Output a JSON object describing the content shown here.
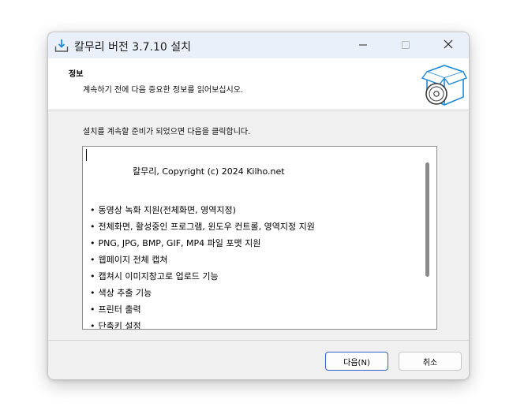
{
  "window": {
    "title": "칼무리 버전 3.7.10 설치"
  },
  "header": {
    "title": "정보",
    "subtitle": "계속하기 전에 다음 중요한 정보를 읽어보십시오."
  },
  "main": {
    "instruction": "설치를 계속할 준비가 되었으면 다음을 클릭합니다.",
    "copyright": "칼무리, Copyright (c) 2024 Kilho.net",
    "bullet": "•",
    "features": [
      "동영상 녹화 지원(전체화면, 영역지정)",
      "전체화면, 활성중인 프로그램, 윈도우 컨트롤, 영역지정 지원",
      "PNG, JPG, BMP, GIF, MP4 파일 포맷 지원",
      "웹페이지 전체 캡쳐",
      "캡쳐시 이미지창고로 업로드 기능",
      "색상 추출 기능",
      "프린터 출력",
      "단축키 설정"
    ]
  },
  "buttons": {
    "next_label": "다음(N)",
    "cancel_label": "취소"
  },
  "colors": {
    "accent": "#2f63c9",
    "titlebar": "#eaf0fa",
    "icon_blue": "#1e88d6"
  },
  "icons": {
    "app": "download-tray-icon",
    "header_graphic": "install-box-disc-icon",
    "minimize": "minimize-icon",
    "maximize": "maximize-icon",
    "close": "close-icon"
  }
}
